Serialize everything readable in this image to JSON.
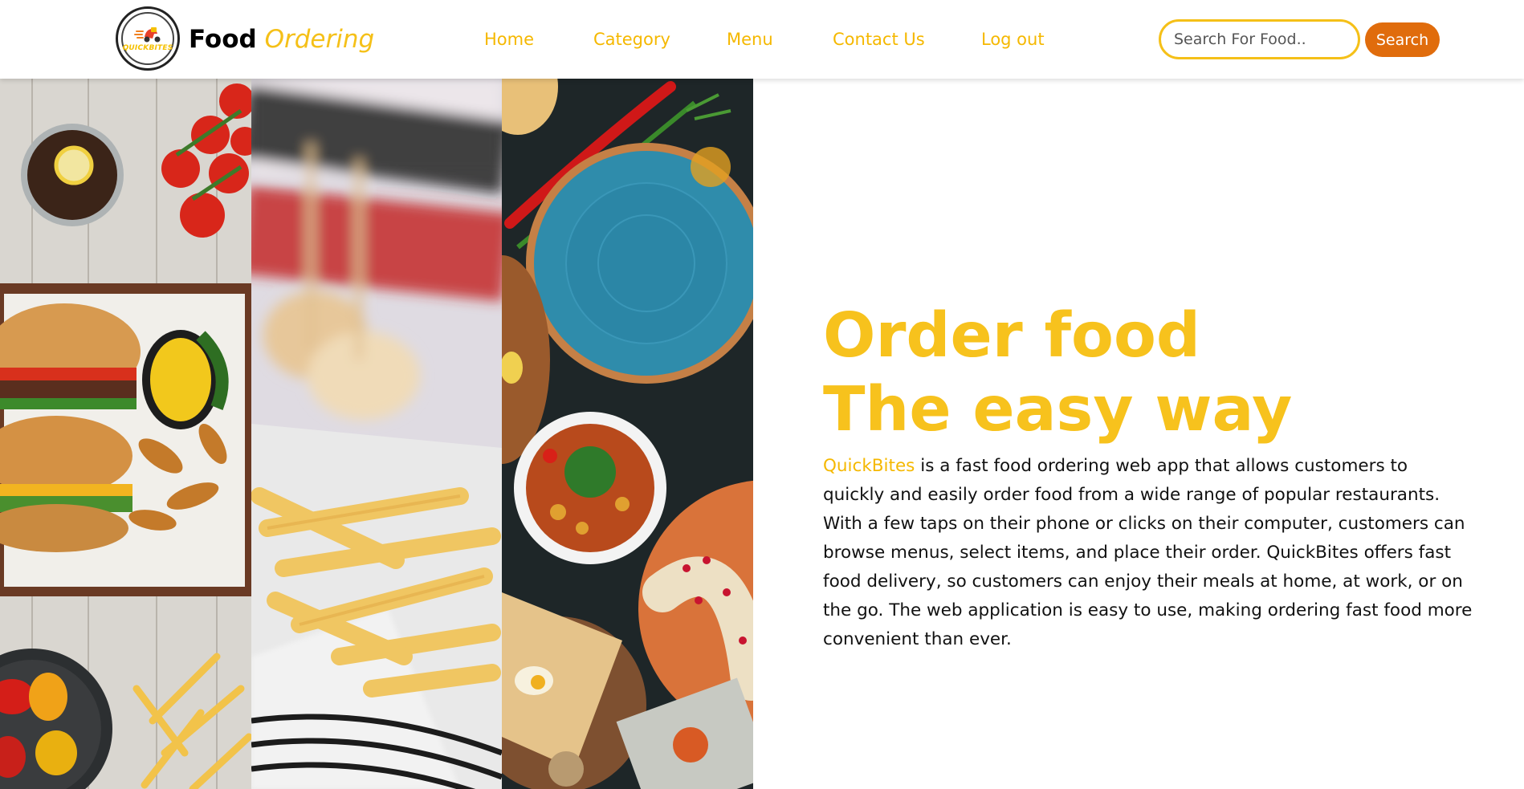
{
  "header": {
    "logo_text": "QUICKBITES",
    "brand_primary": "Food",
    "brand_secondary": "Ordering"
  },
  "nav": {
    "items": [
      {
        "label": "Home"
      },
      {
        "label": "Category"
      },
      {
        "label": "Menu"
      },
      {
        "label": "Contact Us"
      },
      {
        "label": "Log out"
      }
    ]
  },
  "search": {
    "placeholder": "Search For Food..",
    "button_label": "Search"
  },
  "hero": {
    "title_line1": "Order food",
    "title_line2": "The easy way",
    "brand_name": "QuickBites",
    "description": " is a fast food ordering web app that allows customers to quickly and easily order food from a wide range of popular restaurants. With a few taps on their phone or clicks on their computer, customers can browse menus, select items, and place their order. QuickBites offers fast food delivery, so customers can enjoy their meals at home, at work, or on the go. The web application is easy to use, making ordering fast food more convenient than ever."
  },
  "gallery": {
    "panels": [
      {
        "icon": "burger-platter-photo"
      },
      {
        "icon": "fries-basket-photo"
      },
      {
        "icon": "mediterranean-table-photo"
      }
    ]
  },
  "colors": {
    "accent_yellow": "#f7c21d",
    "nav_yellow": "#f5b800",
    "search_button": "#e06c0c"
  }
}
